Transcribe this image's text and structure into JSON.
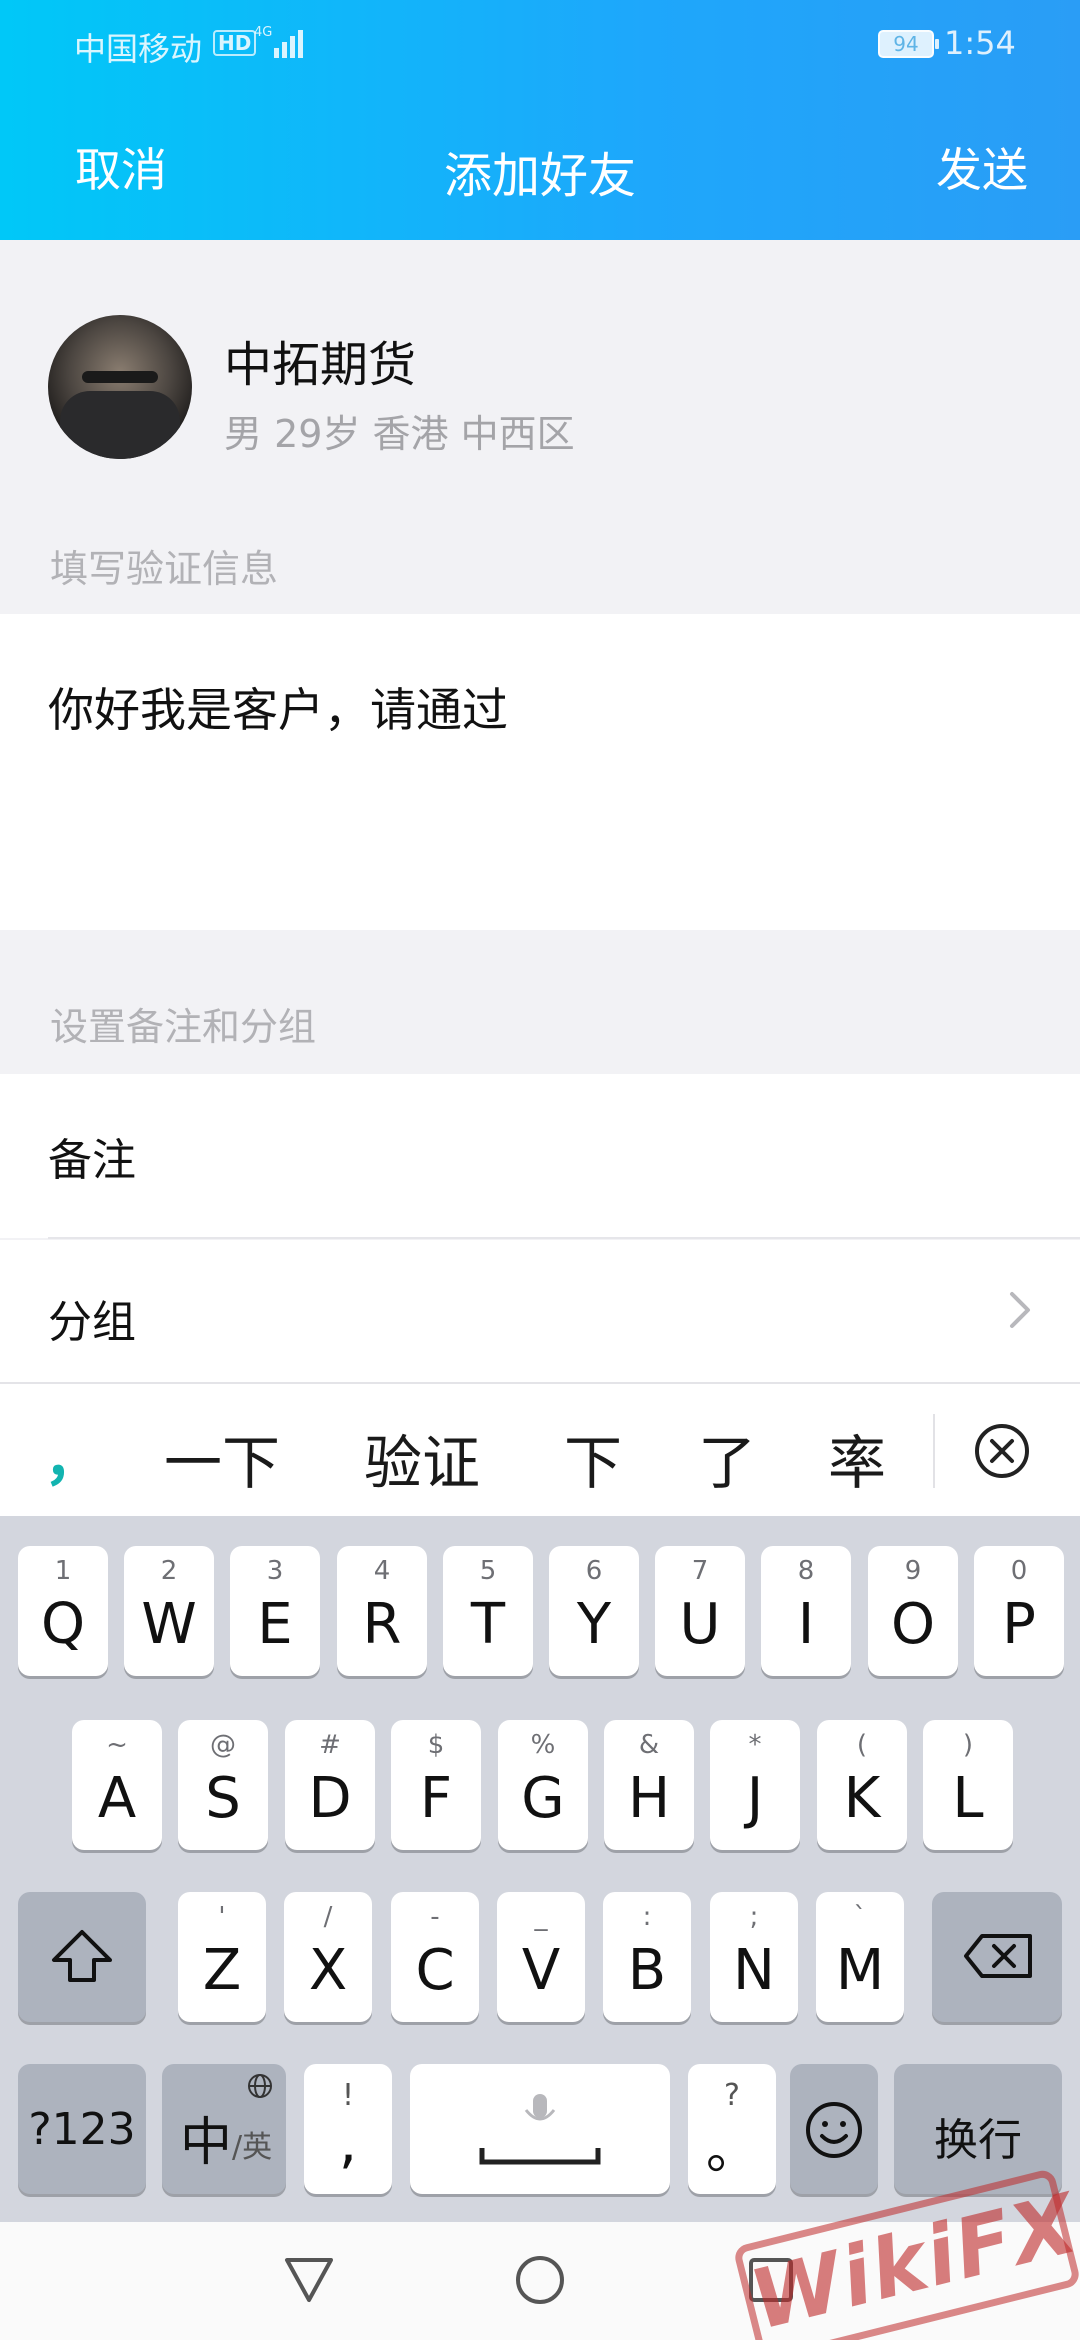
{
  "status_bar": {
    "carrier": "中国移动",
    "hd_badge": "HD",
    "network": "4G",
    "battery": "94",
    "time": "1:54"
  },
  "nav": {
    "cancel": "取消",
    "title": "添加好友",
    "send": "发送"
  },
  "profile": {
    "name": "中拓期货",
    "meta": "男  29岁  香港 中西区"
  },
  "verify": {
    "label": "填写验证信息",
    "message": "你好我是客户，请通过"
  },
  "settings": {
    "label": "设置备注和分组",
    "remark": "备注",
    "group": "分组"
  },
  "candidates": {
    "comma": "，",
    "items": [
      "一下",
      "验证",
      "下",
      "了",
      "率"
    ]
  },
  "keyboard": {
    "row1": [
      {
        "n": "1",
        "c": "Q"
      },
      {
        "n": "2",
        "c": "W"
      },
      {
        "n": "3",
        "c": "E"
      },
      {
        "n": "4",
        "c": "R"
      },
      {
        "n": "5",
        "c": "T"
      },
      {
        "n": "6",
        "c": "Y"
      },
      {
        "n": "7",
        "c": "U"
      },
      {
        "n": "8",
        "c": "I"
      },
      {
        "n": "9",
        "c": "O"
      },
      {
        "n": "0",
        "c": "P"
      }
    ],
    "row2": [
      {
        "n": "~",
        "c": "A"
      },
      {
        "n": "@",
        "c": "S"
      },
      {
        "n": "#",
        "c": "D"
      },
      {
        "n": "$",
        "c": "F"
      },
      {
        "n": "%",
        "c": "G"
      },
      {
        "n": "&",
        "c": "H"
      },
      {
        "n": "*",
        "c": "J"
      },
      {
        "n": "(",
        "c": "K"
      },
      {
        "n": ")",
        "c": "L"
      }
    ],
    "row3": [
      {
        "n": "'",
        "c": "Z"
      },
      {
        "n": "/",
        "c": "X"
      },
      {
        "n": "-",
        "c": "C"
      },
      {
        "n": "_",
        "c": "V"
      },
      {
        "n": ":",
        "c": "B"
      },
      {
        "n": ";",
        "c": "N"
      },
      {
        "n": "`",
        "c": "M"
      }
    ],
    "sym_key": "?123",
    "lang_main": "中",
    "lang_sub": "/英",
    "comma_top": "!",
    "comma_main": ",",
    "period_top": "?",
    "period_main": "。",
    "enter": "换行"
  },
  "watermark": "WikiFX",
  "colors": {
    "header_start": "#00c8f8",
    "header_end": "#2a9df6",
    "candidate_accent": "#12b4b0"
  }
}
